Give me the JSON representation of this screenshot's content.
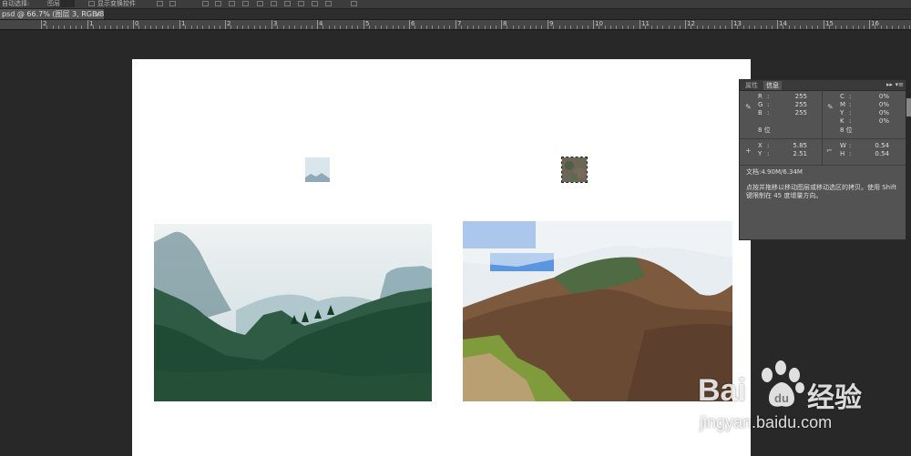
{
  "options_bar": {
    "items": [
      "自动选择:",
      "图层",
      "显示变换控件"
    ]
  },
  "document_tab": {
    "title": "psd @ 66.7% (图层 3, RGB/8) *",
    "close": "×"
  },
  "ruler": {
    "labels": [
      "2",
      "1",
      "0",
      "1",
      "2",
      "3",
      "4",
      "5",
      "6",
      "7",
      "8",
      "9",
      "10",
      "11",
      "12",
      "13",
      "14",
      "15",
      "16"
    ]
  },
  "info_panel": {
    "tabs": [
      "属性",
      "信息"
    ],
    "active_tab": "信息",
    "rgb": [
      {
        "k": "R",
        "v": "255"
      },
      {
        "k": "G",
        "v": "255"
      },
      {
        "k": "B",
        "v": "255"
      }
    ],
    "cmyk": [
      {
        "k": "C",
        "v": "0%"
      },
      {
        "k": "M",
        "v": "0%"
      },
      {
        "k": "Y",
        "v": "0%"
      },
      {
        "k": "K",
        "v": "0%"
      }
    ],
    "bit_left": "8 位",
    "bit_right": "8 位",
    "xy": [
      {
        "k": "X",
        "v": "5.85"
      },
      {
        "k": "Y",
        "v": "2.51"
      }
    ],
    "wh": [
      {
        "k": "W",
        "v": "0.54"
      },
      {
        "k": "H",
        "v": "0.54"
      }
    ],
    "doc": "文档:4.90M/6.34M",
    "hint": "点按并拖移以移动图层或移动选区的拷贝。使用 Shift 键限制在 45 度增量方向。"
  },
  "watermark": {
    "brand": "Bai",
    "brand_cn": "经验",
    "url": "jingyan.baidu.com"
  },
  "colors": {
    "canvas": "#ffffff",
    "workspace": "#282828",
    "panel": "#535353"
  }
}
